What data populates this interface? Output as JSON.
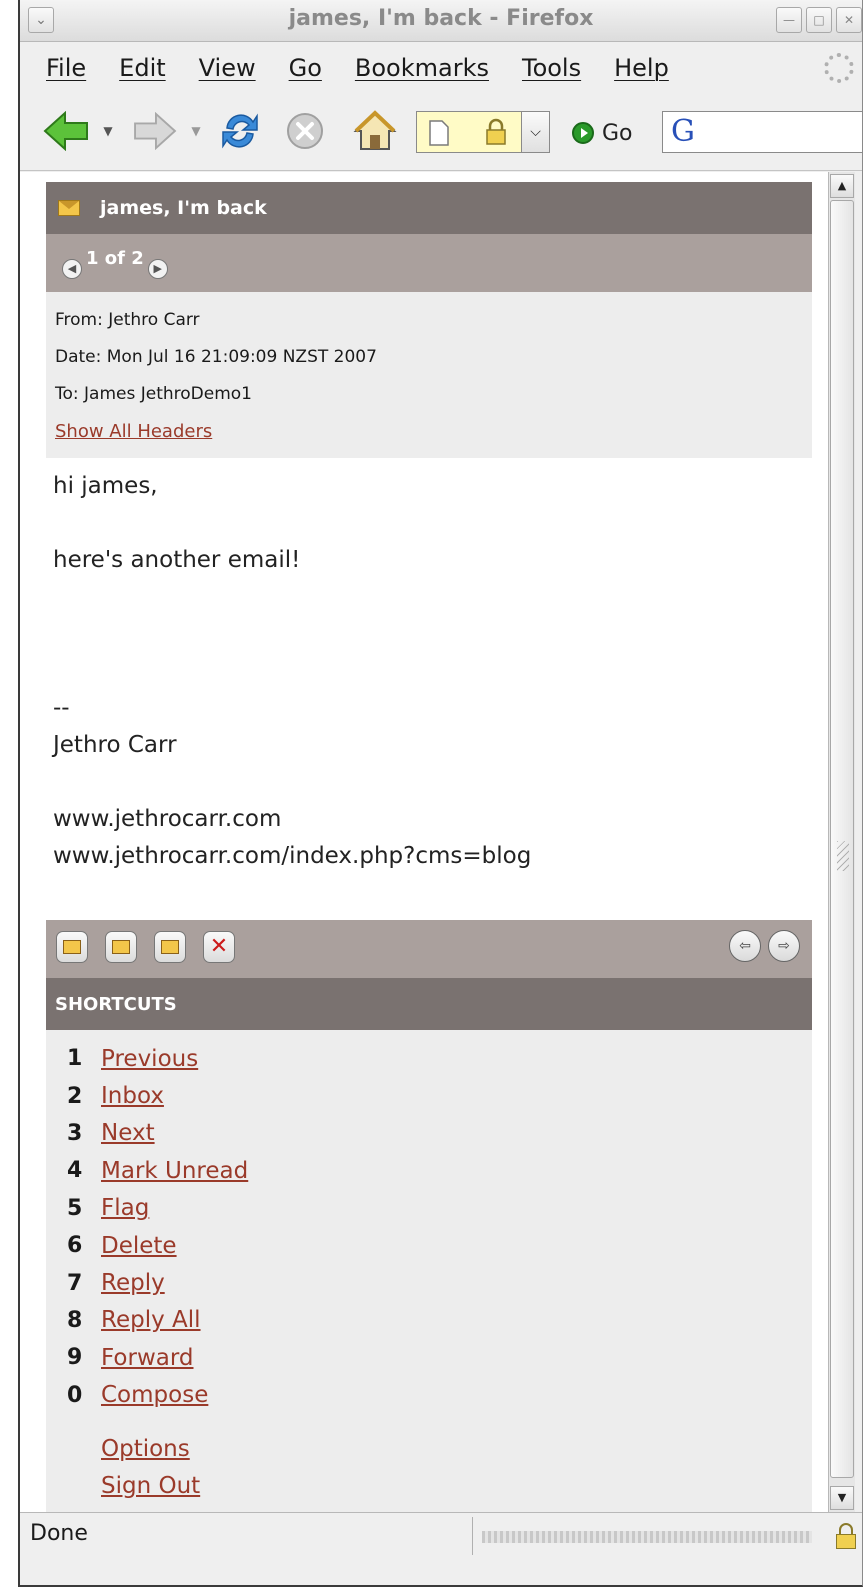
{
  "window": {
    "title": "james, I'm back - Firefox"
  },
  "menu": {
    "items": [
      "File",
      "Edit",
      "View",
      "Go",
      "Bookmarks",
      "Tools",
      "Help"
    ]
  },
  "toolbar": {
    "go_label": "Go",
    "search_logo": "G"
  },
  "icons": {
    "back": "back-arrow-icon",
    "forward": "forward-arrow-icon",
    "reload": "reload-icon",
    "stop": "stop-icon",
    "home": "home-icon",
    "page": "page-icon",
    "lock": "lock-icon"
  },
  "message": {
    "subject": "james, I'm back",
    "pager": "1 of 2",
    "from": "From: Jethro Carr",
    "date": "Date: Mon Jul 16 21:09:09 NZST 2007",
    "to": "To: James JethroDemo1",
    "show_all_headers": "Show All Headers",
    "body": [
      "hi james,",
      "",
      "here's another email!",
      "",
      "",
      "",
      "--",
      "Jethro Carr",
      "",
      "www.jethrocarr.com",
      "www.jethrocarr.com/index.php?cms=blog"
    ]
  },
  "shortcuts": {
    "title": "SHORTCUTS",
    "items": [
      {
        "key": "1",
        "label": "Previous"
      },
      {
        "key": "2",
        "label": "Inbox"
      },
      {
        "key": "3",
        "label": "Next"
      },
      {
        "key": "4",
        "label": "Mark Unread"
      },
      {
        "key": "5",
        "label": "Flag"
      },
      {
        "key": "6",
        "label": "Delete"
      },
      {
        "key": "7",
        "label": "Reply"
      },
      {
        "key": "8",
        "label": "Reply All"
      },
      {
        "key": "9",
        "label": "Forward"
      },
      {
        "key": "0",
        "label": "Compose"
      }
    ],
    "extra": [
      "Options",
      "Sign Out"
    ]
  },
  "status": {
    "text": "Done"
  },
  "colors": {
    "header_dark": "#7a7270",
    "header_light": "#aaa09d",
    "link": "#9a3a2a",
    "panel": "#ededed"
  }
}
